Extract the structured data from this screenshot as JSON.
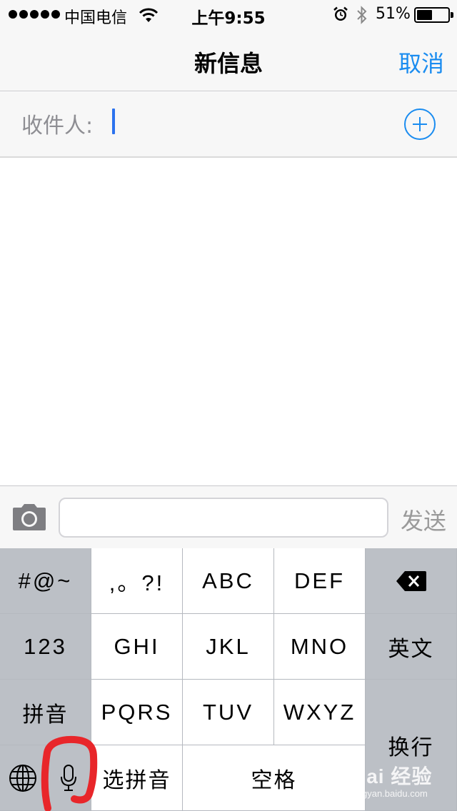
{
  "status_bar": {
    "carrier": "中国电信",
    "time": "上午9:55",
    "battery_percent": "51%",
    "battery_level": 0.51,
    "signal_bars": 5
  },
  "nav": {
    "title": "新信息",
    "cancel_label": "取消"
  },
  "recipient": {
    "label": "收件人:",
    "value": ""
  },
  "compose": {
    "message_value": "",
    "send_label": "发送"
  },
  "keyboard": {
    "symbols_key": "#@~",
    "punct_key": ",。?!",
    "abc_key": "ABC",
    "def_key": "DEF",
    "numbers_key": "123",
    "ghi_key": "GHI",
    "jkl_key": "JKL",
    "mno_key": "MNO",
    "english_key": "英文",
    "pinyin_key": "拼音",
    "pqrs_key": "PQRS",
    "tuv_key": "TUV",
    "wxyz_key": "WXYZ",
    "return_key": "换行",
    "select_pinyin_key": "选拼音",
    "space_key": "空格"
  },
  "watermark": {
    "main": "Bai 经验",
    "sub": "jingyan.baidu.com"
  },
  "colors": {
    "accent": "#1a8cf0",
    "cursor": "#2b72ee",
    "annotation": "#e8262a"
  },
  "icons": [
    "signal-dots-icon",
    "wifi-icon",
    "alarm-icon",
    "bluetooth-icon",
    "battery-icon",
    "add-contact-icon",
    "camera-icon",
    "delete-icon",
    "globe-icon",
    "microphone-icon"
  ]
}
